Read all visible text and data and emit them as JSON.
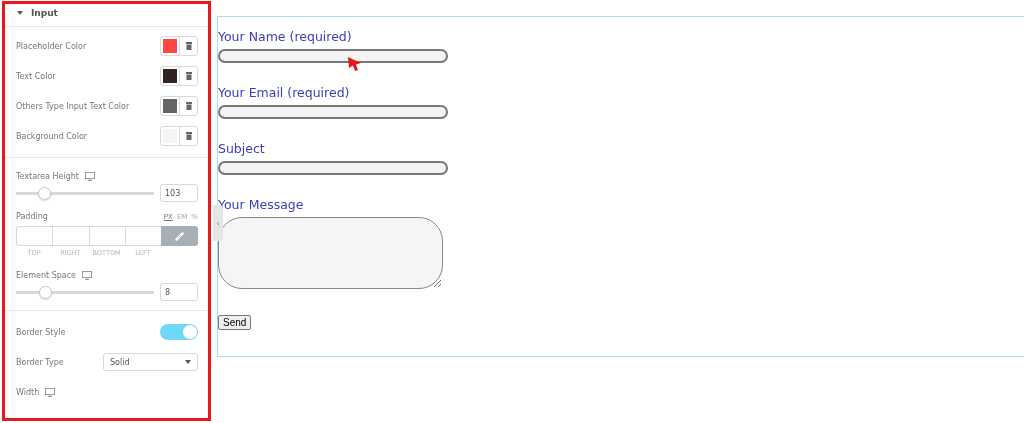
{
  "panel": {
    "section": {
      "title": "Input",
      "expanded": true
    },
    "colors": [
      {
        "label": "Placeholder Color",
        "color": "#ff4545"
      },
      {
        "label": "Text Color",
        "color": "#332222"
      },
      {
        "label": "Others Type Input Text Color",
        "color": "#666666"
      },
      {
        "label": "Background Color",
        "color": "#f5f5f5"
      }
    ],
    "textarea_height": {
      "label": "Textarea Height",
      "level": 0.2,
      "value": "103"
    },
    "padding": {
      "label": "Padding",
      "units": [
        {
          "label": "PX",
          "selected": true
        },
        {
          "label": "EM",
          "selected": false
        },
        {
          "label": "%",
          "selected": false
        }
      ],
      "sides": [
        "TOP",
        "RIGHT",
        "BOTTOM",
        "LEFT"
      ],
      "linked": true
    },
    "element_space": {
      "label": "Element Space",
      "level": 0.21,
      "value": "8"
    },
    "border_style": {
      "label": "Border Style",
      "on": true
    },
    "border_type": {
      "label": "Border Type",
      "value": "Solid"
    },
    "width": {
      "label": "Width"
    }
  },
  "collapse_handle": "‹",
  "form": {
    "fields": [
      {
        "label": "Your Name (required)",
        "kind": "input"
      },
      {
        "label": "Your Email (required)",
        "kind": "input"
      },
      {
        "label": "Subject",
        "kind": "input"
      },
      {
        "label": "Your Message",
        "kind": "textarea"
      }
    ],
    "submit": "Send"
  }
}
